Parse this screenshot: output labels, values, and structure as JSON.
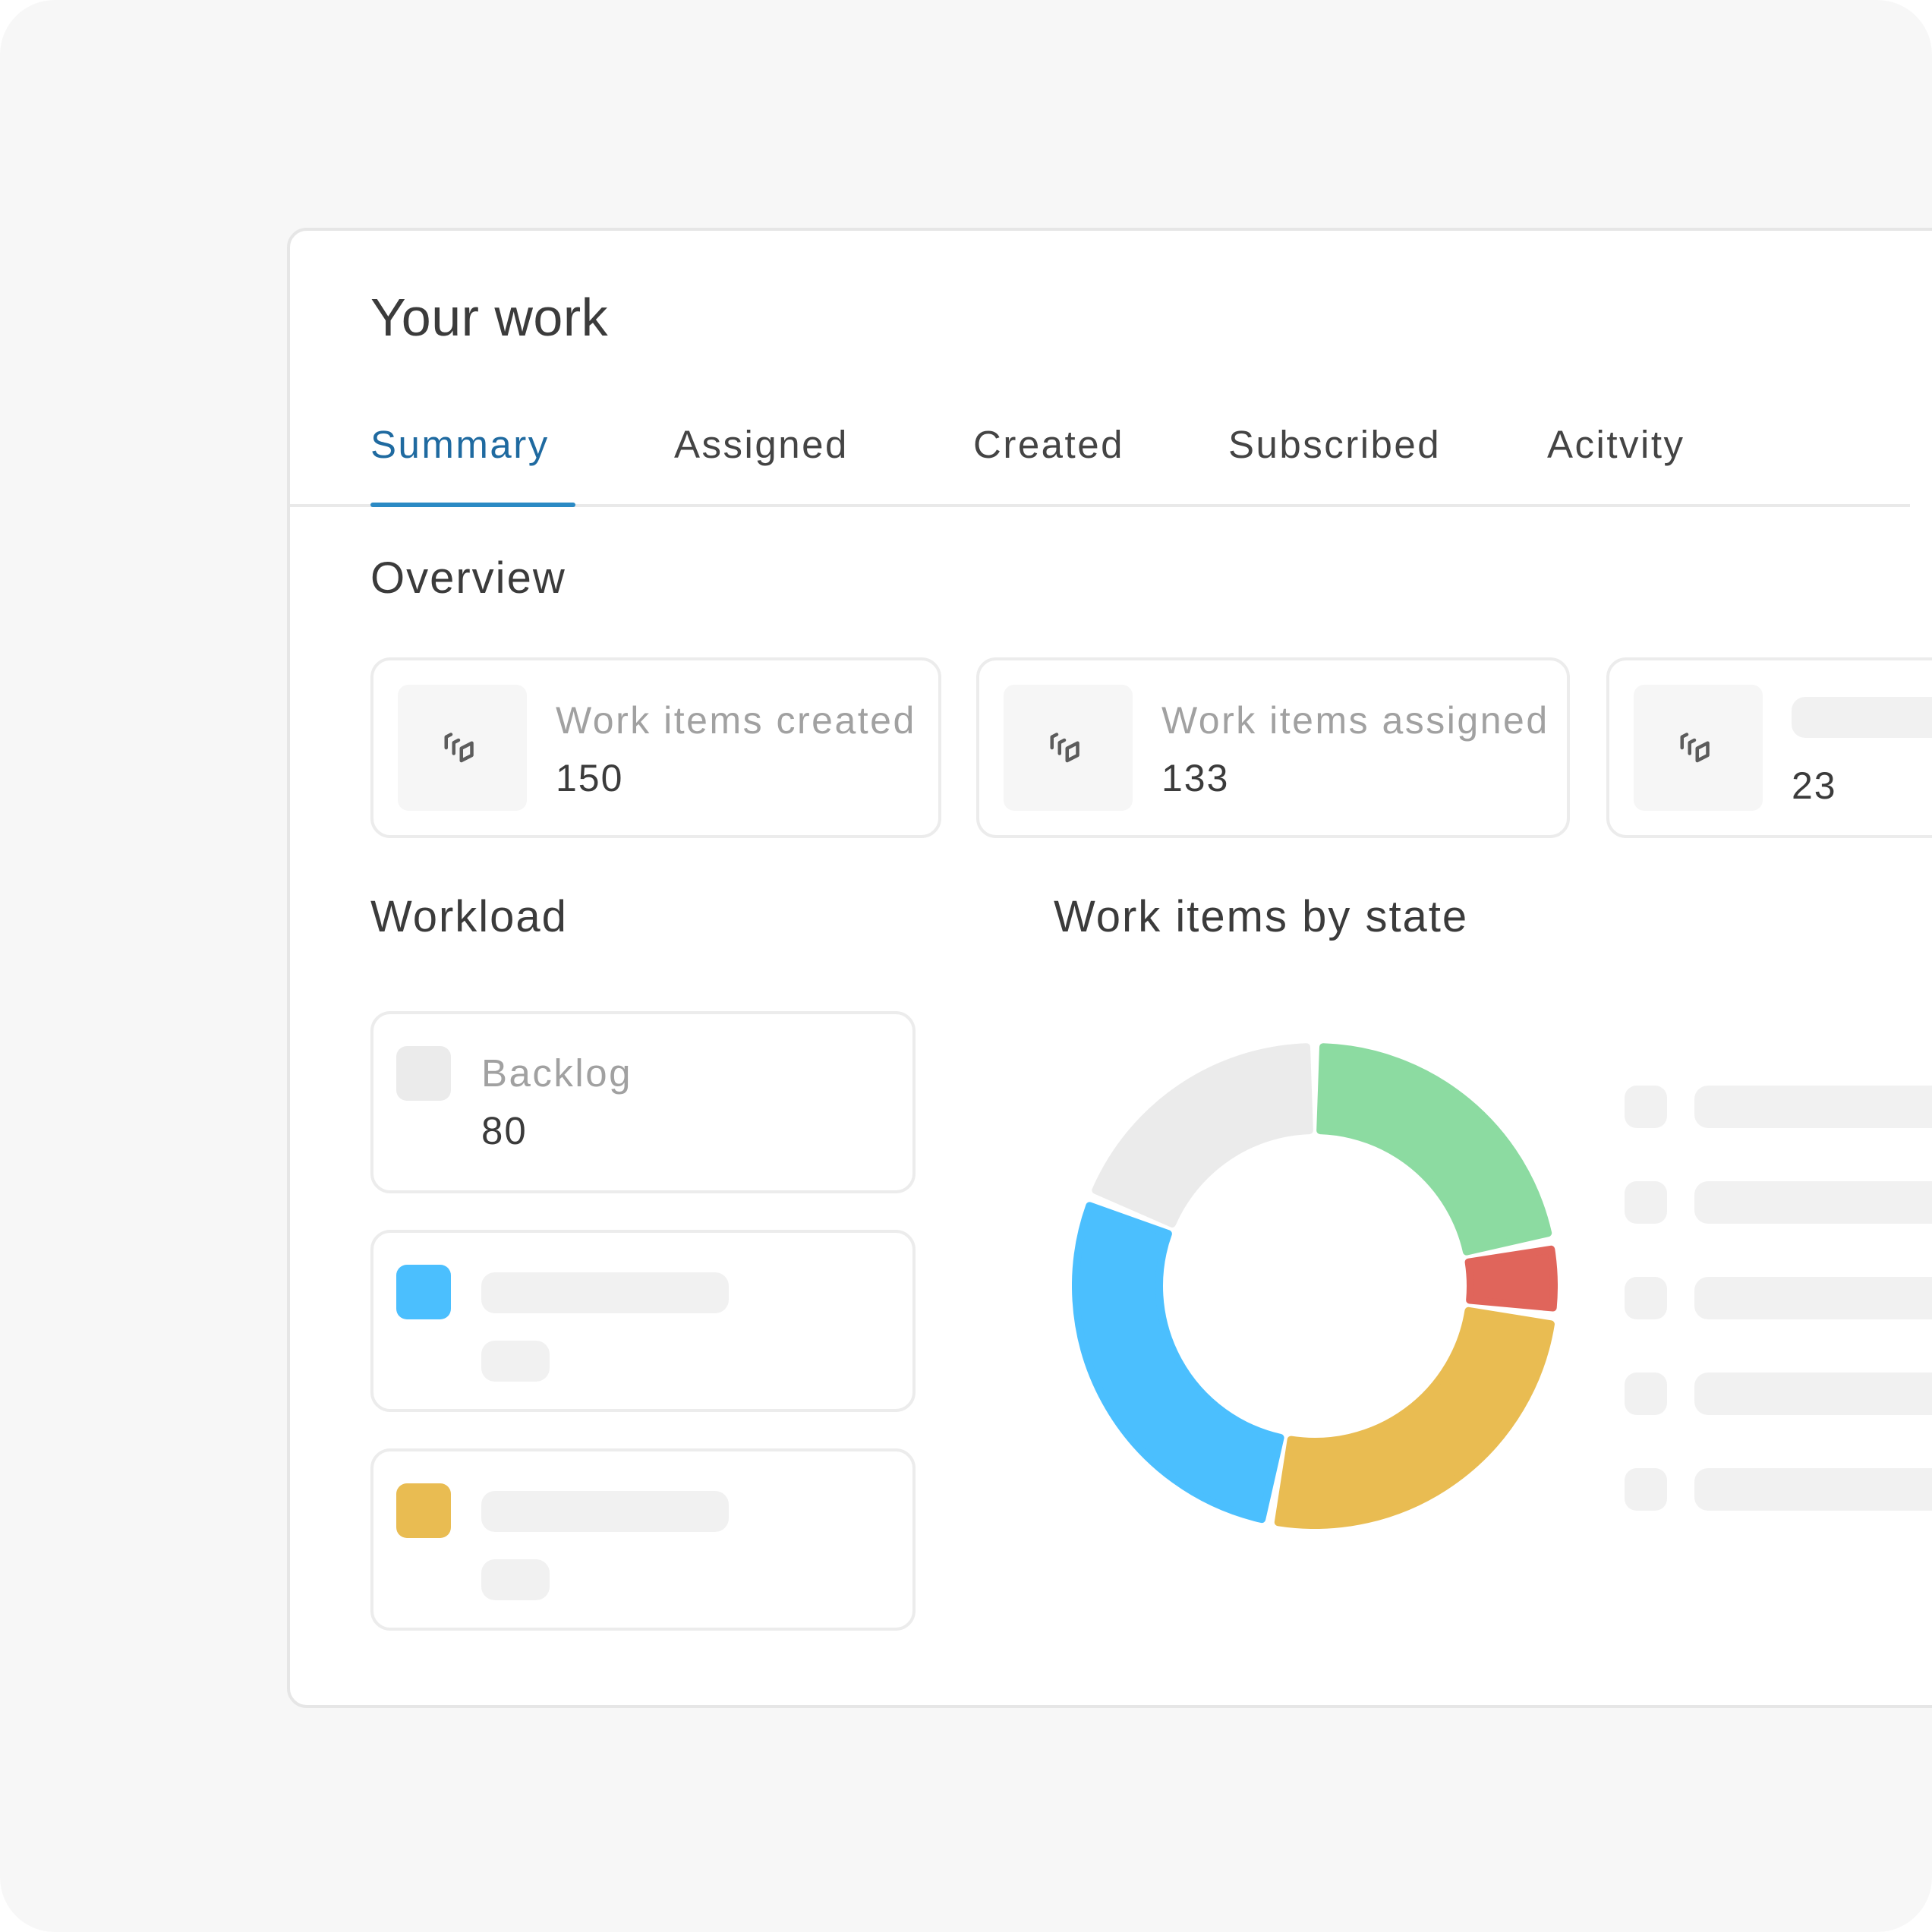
{
  "page": {
    "title": "Your work",
    "tabs": [
      {
        "label": "Summary",
        "active": true
      },
      {
        "label": "Assigned",
        "active": false
      },
      {
        "label": "Created",
        "active": false
      },
      {
        "label": "Subscribed",
        "active": false
      },
      {
        "label": "Acitvity",
        "active": false
      }
    ]
  },
  "overview": {
    "title": "Overview",
    "cards": [
      {
        "label": "Work items created",
        "value": "150",
        "icon": "layers-icon"
      },
      {
        "label": "Work items assigned",
        "value": "133",
        "icon": "layers-icon"
      },
      {
        "label": "",
        "value": "23",
        "icon": "layers-icon"
      }
    ]
  },
  "workload": {
    "title": "Workload",
    "items": [
      {
        "label": "Backlog",
        "value": "80",
        "color": "#ebebeb"
      },
      {
        "label": "",
        "value": "",
        "color": "#4bbffe"
      },
      {
        "label": "",
        "value": "",
        "color": "#e9bc52"
      }
    ]
  },
  "by_state": {
    "title": "Work items by state"
  },
  "chart_data": {
    "type": "pie",
    "title": "",
    "slices": [
      {
        "name": "",
        "value": 22,
        "color": "#8cdba1"
      },
      {
        "name": "",
        "value": 5,
        "color": "#e0655b"
      },
      {
        "name": "",
        "value": 26,
        "color": "#e9bc52"
      },
      {
        "name": "",
        "value": 28,
        "color": "#4bbffe"
      },
      {
        "name": "",
        "value": 19,
        "color": "#ebebeb"
      }
    ],
    "legend": "right"
  },
  "colors": {
    "accent": "#1f6aa0",
    "tab_underline": "#2b8ac4",
    "skeleton": "#f1f1f1"
  }
}
